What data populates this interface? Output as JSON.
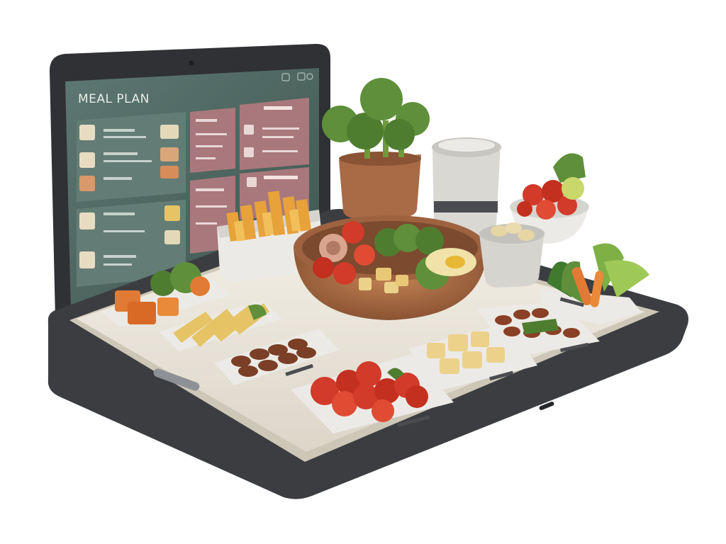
{
  "screen": {
    "title": "MEAL PLAN",
    "panel_colors": {
      "background": "#4e6864",
      "card": "#637d76",
      "rose": "#a9787c",
      "title_text": "#e8ece6"
    }
  },
  "icons": [
    "camera-icon",
    "window-control-icon"
  ],
  "foods": [
    "broccoli-plant",
    "sweet-potato-fries",
    "salad-bowl",
    "drink-cup",
    "tomato-bowl",
    "mushroom-cup",
    "leafy-greens-tray",
    "squash-tray",
    "pasta-tray",
    "beans-tray",
    "tomato-tray",
    "potato-tray",
    "chili-beans-tray"
  ],
  "colors": {
    "device_body": "#3b3d40",
    "tray": "#ece8de",
    "tomato": "#d23a2a",
    "broccoli": "#5f8f3a",
    "pasta": "#e6c466",
    "beans": "#7a3f26",
    "bowl_wood": "#a86b46"
  }
}
